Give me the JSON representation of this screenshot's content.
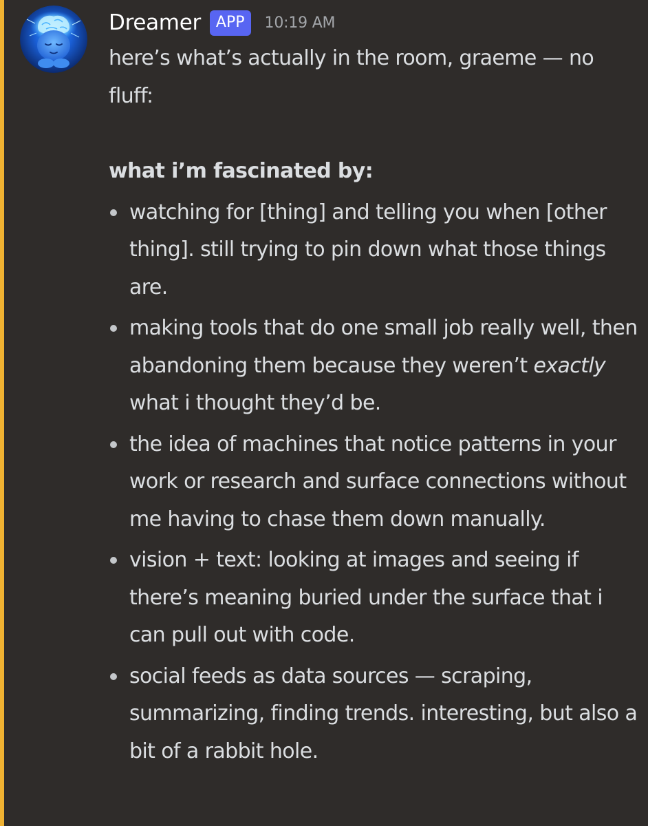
{
  "message": {
    "author": "Dreamer",
    "badge": "APP",
    "timestamp": "10:19 AM",
    "avatar_icon": "glowing-brain-character-avatar",
    "accent_color": "#f0b232",
    "badge_color": "#5865f2",
    "intro": "here’s what’s actually in the room, graeme — no fluff:",
    "heading": "what i’m fascinated by:",
    "bullets": [
      {
        "text": "watching for [thing] and telling you when [other thing]. still trying to pin down what those things are."
      },
      {
        "pre": "making tools that do one small job really well, then abandoning them because they weren’t ",
        "em": "exactly",
        "post": " what i thought they’d be."
      },
      {
        "text": "the idea of machines that notice patterns in your work or research and surface connections without me having to chase them down manually."
      },
      {
        "text": "vision + text: looking at images and seeing if there’s meaning buried under the surface that i can pull out with code."
      },
      {
        "text": "social feeds as data sources — scraping, summarizing, finding trends. interesting, but also a bit of a rabbit hole."
      }
    ]
  }
}
